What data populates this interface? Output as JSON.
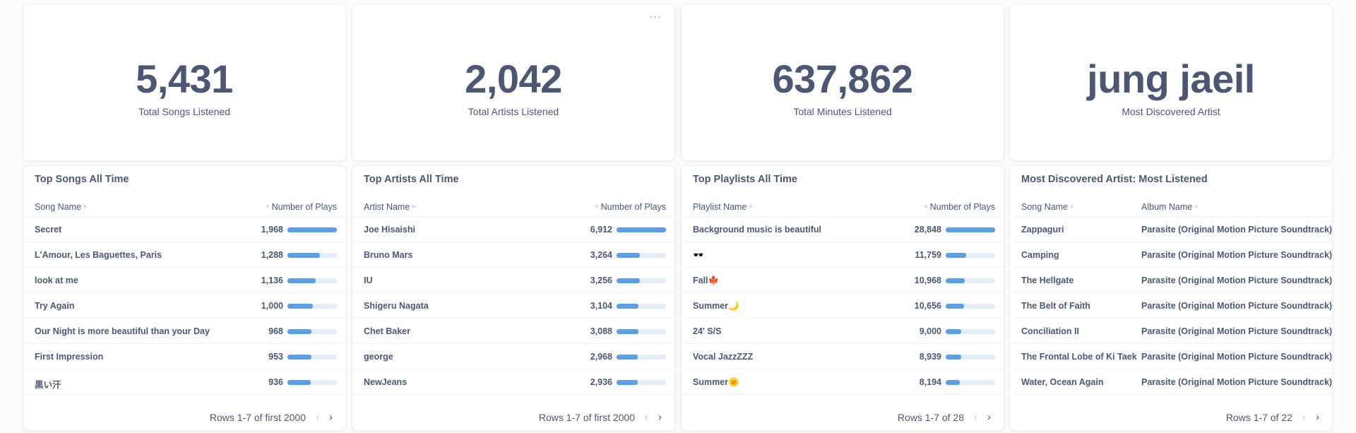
{
  "scalars": [
    {
      "value": "5,431",
      "label": "Total Songs Listened"
    },
    {
      "value": "2,042",
      "label": "Total Artists Listened"
    },
    {
      "value": "637,862",
      "label": "Total Minutes Listened"
    },
    {
      "value": "jung jaeil",
      "label": "Most Discovered Artist"
    }
  ],
  "menu_dots": "···",
  "sort_icon": "^",
  "tables": [
    {
      "title": "Top Songs All Time",
      "col1": "Song Name",
      "col2": "Number of Plays",
      "rows": [
        {
          "name": "Secret",
          "plays": "1,968",
          "fraction": 1.0
        },
        {
          "name": "L'Amour, Les Baguettes, Paris",
          "plays": "1,288",
          "fraction": 0.654
        },
        {
          "name": "look at me",
          "plays": "1,136",
          "fraction": 0.577
        },
        {
          "name": "Try Again",
          "plays": "1,000",
          "fraction": 0.508
        },
        {
          "name": "Our Night is more beautiful than your Day",
          "plays": "968",
          "fraction": 0.492
        },
        {
          "name": "First Impression",
          "plays": "953",
          "fraction": 0.484
        },
        {
          "name": "黒い汗",
          "plays": "936",
          "fraction": 0.476
        }
      ],
      "pager": "Rows 1-7 of first 2000"
    },
    {
      "title": "Top Artists All Time",
      "col1": "Artist Name",
      "col2": "Number of Plays",
      "rows": [
        {
          "name": "Joe Hisaishi",
          "plays": "6,912",
          "fraction": 1.0
        },
        {
          "name": "Bruno Mars",
          "plays": "3,264",
          "fraction": 0.472
        },
        {
          "name": "IU",
          "plays": "3,256",
          "fraction": 0.471
        },
        {
          "name": "Shigeru Nagata",
          "plays": "3,104",
          "fraction": 0.449
        },
        {
          "name": "Chet Baker",
          "plays": "3,088",
          "fraction": 0.447
        },
        {
          "name": "george",
          "plays": "2,968",
          "fraction": 0.429
        },
        {
          "name": "NewJeans",
          "plays": "2,936",
          "fraction": 0.425
        }
      ],
      "pager": "Rows 1-7 of first 2000"
    },
    {
      "title": "Top Playlists All Time",
      "col1": "Playlist Name",
      "col2": "Number of Plays",
      "rows": [
        {
          "name": "Background music is beautiful",
          "plays": "28,848",
          "fraction": 1.0
        },
        {
          "name": "🕶️",
          "plays": "11,759",
          "fraction": 0.408
        },
        {
          "name": "Fall🍁",
          "plays": "10,968",
          "fraction": 0.38
        },
        {
          "name": "Summer🌙",
          "plays": "10,656",
          "fraction": 0.369
        },
        {
          "name": "24' S/S",
          "plays": "9,000",
          "fraction": 0.312
        },
        {
          "name": "Vocal JazzZZZ",
          "plays": "8,939",
          "fraction": 0.31
        },
        {
          "name": "Summer🌞",
          "plays": "8,194",
          "fraction": 0.284
        }
      ],
      "pager": "Rows 1-7 of 28"
    }
  ],
  "discovered": {
    "title": "Most Discovered Artist: Most Listened",
    "col1": "Song Name",
    "col2": "Album Name",
    "rows": [
      {
        "name": "Zappaguri",
        "album": "Parasite (Original Motion Picture Soundtrack)"
      },
      {
        "name": "Camping",
        "album": "Parasite (Original Motion Picture Soundtrack)"
      },
      {
        "name": "The Hellgate",
        "album": "Parasite (Original Motion Picture Soundtrack)"
      },
      {
        "name": "The Belt of Faith",
        "album": "Parasite (Original Motion Picture Soundtrack)"
      },
      {
        "name": "Conciliation II",
        "album": "Parasite (Original Motion Picture Soundtrack)"
      },
      {
        "name": "The Frontal Lobe of Ki Taek",
        "album": "Parasite (Original Motion Picture Soundtrack)"
      },
      {
        "name": "Water, Ocean Again",
        "album": "Parasite (Original Motion Picture Soundtrack)"
      }
    ],
    "pager": "Rows 1-7 of 22"
  },
  "arrows": {
    "prev": "‹",
    "next": "›"
  },
  "colors": {
    "bar_fill": "#5f9ddf",
    "bar_track": "#e5edf7",
    "text": "#4c5773"
  }
}
